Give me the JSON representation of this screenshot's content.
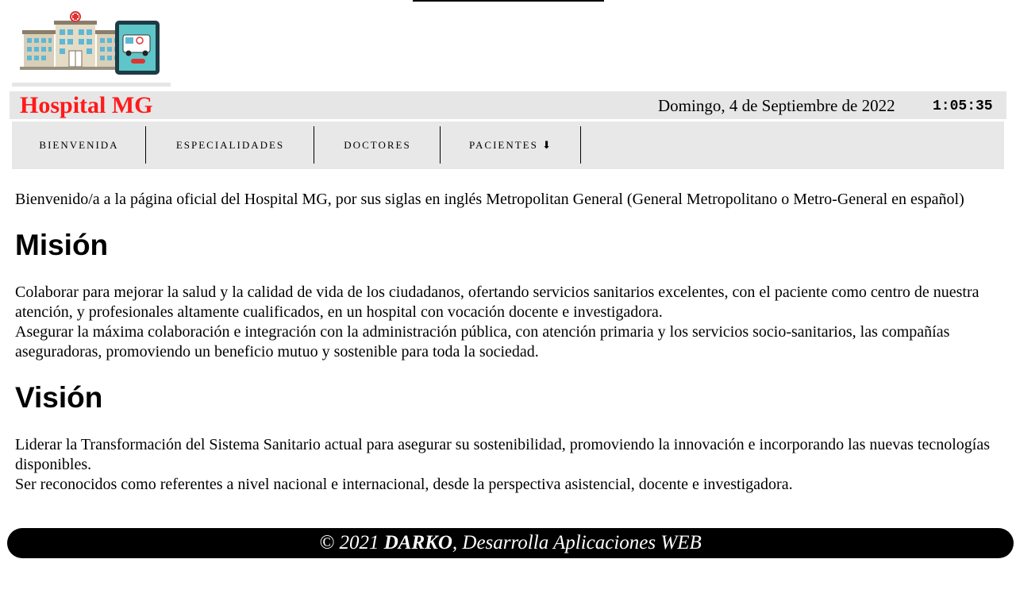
{
  "header": {
    "site_title": "Hospital MG",
    "date": "Domingo, 4 de Septiembre de 2022",
    "clock": "1:05:35",
    "title_color": "#ff1a1a",
    "logo_icons": [
      "hospital-building-icon",
      "ambulance-phone-icon"
    ]
  },
  "nav": {
    "items": [
      {
        "label": "BIENVENIDA"
      },
      {
        "label": "ESPECIALIDADES"
      },
      {
        "label": "DOCTORES"
      },
      {
        "label": "PACIENTES ⬇"
      }
    ]
  },
  "main": {
    "intro": "Bienvenido/a a la página oficial del Hospital MG, por sus siglas en inglés Metropolitan General (General Metropolitano o Metro-General en español)",
    "mission": {
      "heading": "Misión",
      "p1": "Colaborar para mejorar la salud y la calidad de vida de los ciudadanos, ofertando servicios sanitarios excelentes, con el paciente como centro de nuestra atención, y profesionales altamente cualificados, en un hospital con vocación docente e investigadora.",
      "p2": "Asegurar la máxima colaboración e integración con la administración pública, con atención primaria y los servicios socio-sanitarios, las compañías aseguradoras, promoviendo un beneficio mutuo y sostenible para toda la sociedad."
    },
    "vision": {
      "heading": "Visión",
      "p1": "Liderar la Transformación del Sistema Sanitario actual para asegurar su sostenibilidad, promoviendo la innovación e incorporando las nuevas tecnologías disponibles.",
      "p2": "Ser reconocidos como referentes a nivel nacional e internacional, desde la perspectiva asistencial, docente e investigadora."
    }
  },
  "footer": {
    "prefix": "© 2021 ",
    "author": "DARKO",
    "suffix": ", Desarrolla Aplicaciones WEB"
  }
}
